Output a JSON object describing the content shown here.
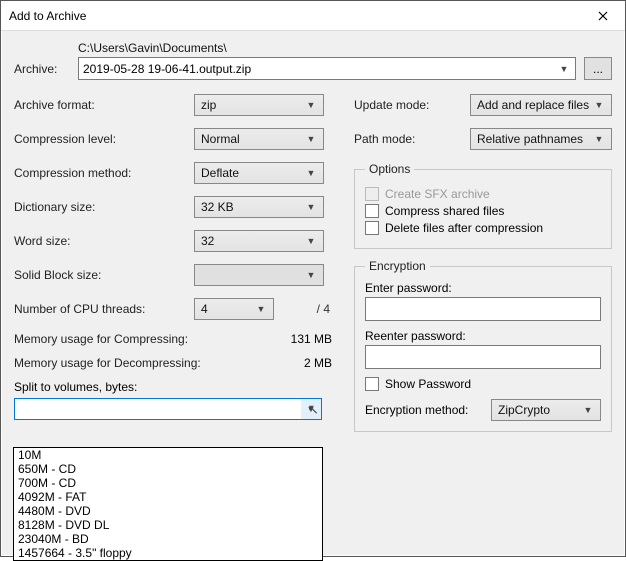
{
  "title": "Add to Archive",
  "archive": {
    "label": "Archive:",
    "path": "C:\\Users\\Gavin\\Documents\\",
    "filename": "2019-05-28 19-06-41.output.zip",
    "browse": "..."
  },
  "left": {
    "format_label": "Archive format:",
    "format_value": "zip",
    "level_label": "Compression level:",
    "level_value": "Normal",
    "method_label": "Compression method:",
    "method_value": "Deflate",
    "dict_label": "Dictionary size:",
    "dict_value": "32 KB",
    "word_label": "Word size:",
    "word_value": "32",
    "block_label": "Solid Block size:",
    "block_value": "",
    "cpu_label": "Number of CPU threads:",
    "cpu_value": "4",
    "cpu_total": "/ 4",
    "mem_comp_label": "Memory usage for Compressing:",
    "mem_comp_value": "131 MB",
    "mem_decomp_label": "Memory usage for Decompressing:",
    "mem_decomp_value": "2 MB",
    "split_label": "Split to volumes, bytes:",
    "split_options": [
      "10M",
      "650M - CD",
      "700M - CD",
      "4092M - FAT",
      "4480M - DVD",
      "8128M - DVD DL",
      "23040M - BD",
      "1457664 - 3.5\" floppy"
    ]
  },
  "right": {
    "update_label": "Update mode:",
    "update_value": "Add and replace files",
    "path_label": "Path mode:",
    "path_value": "Relative pathnames",
    "options_legend": "Options",
    "opt_sfx": "Create SFX archive",
    "opt_shared": "Compress shared files",
    "opt_delete": "Delete files after compression",
    "enc_legend": "Encryption",
    "enter_pw": "Enter password:",
    "reenter_pw": "Reenter password:",
    "show_pw": "Show Password",
    "enc_method_label": "Encryption method:",
    "enc_method_value": "ZipCrypto"
  }
}
